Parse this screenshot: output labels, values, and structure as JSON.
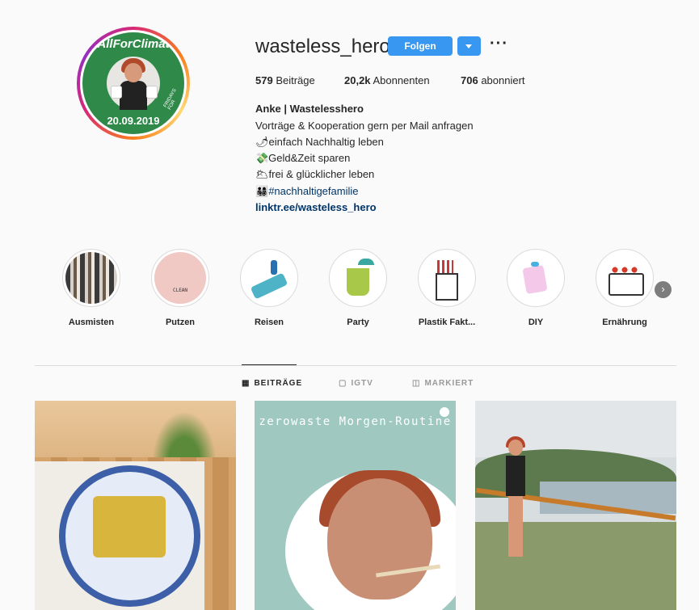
{
  "profile": {
    "username": "wasteless_hero",
    "follow_label": "Folgen",
    "more_label": "···",
    "avatar": {
      "top_text": "#AllForClimate",
      "bottom_text": "20.09.2019",
      "side_text": "FRIDAYS FOR"
    }
  },
  "stats": {
    "posts_count": "579",
    "posts_label": "Beiträge",
    "followers_count": "20,2k",
    "followers_label": "Abonnenten",
    "following_count": "706",
    "following_label": "abonniert"
  },
  "bio": {
    "name": "Anke | Wastelesshero",
    "line1": "Vorträge & Kooperation gern per Mail anfragen",
    "line2": "🌶einfach Nachhaltig leben",
    "line3": "💸Geld&Zeit sparen",
    "line4": "🌥frei & glücklicher leben",
    "line5_icon": "👨‍👩‍👧‍👦",
    "line5_tag": "#nachhaltigefamilie",
    "link": "linktr.ee/wasteless_hero"
  },
  "highlights": [
    {
      "label": "Ausmisten"
    },
    {
      "label": "Putzen",
      "image_text": "CLEAN"
    },
    {
      "label": "Reisen"
    },
    {
      "label": "Party"
    },
    {
      "label": "Plastik Fakt..."
    },
    {
      "label": "DIY"
    },
    {
      "label": "Ernährung"
    }
  ],
  "tabs": [
    {
      "label": "BEITRÄGE",
      "icon": "grid-icon",
      "active": true
    },
    {
      "label": "IGTV",
      "icon": "tv-icon",
      "active": false
    },
    {
      "label": "MARKIERT",
      "icon": "tag-icon",
      "active": false
    }
  ],
  "posts": [
    {
      "type": "food"
    },
    {
      "type": "video",
      "title": "zerowaste Morgen-Routine"
    },
    {
      "type": "landscape"
    }
  ],
  "colors": {
    "accent": "#3897f0",
    "link": "#003569",
    "text": "#262626",
    "border": "#dbdbdb"
  }
}
